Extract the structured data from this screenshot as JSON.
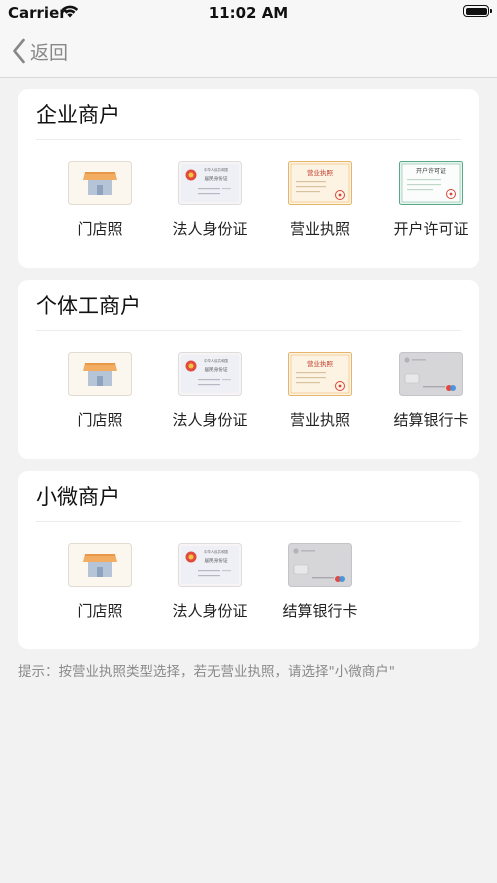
{
  "status_bar": {
    "carrier": "Carrier",
    "time": "11:02 AM"
  },
  "nav": {
    "back_label": "返回"
  },
  "sections": [
    {
      "title": "企业商户",
      "items": [
        {
          "label": "门店照",
          "icon": "storefront-photo-icon"
        },
        {
          "label": "法人身份证",
          "icon": "id-card-icon"
        },
        {
          "label": "营业执照",
          "icon": "business-license-icon"
        },
        {
          "label": "开户许可证",
          "icon": "account-permit-icon"
        }
      ]
    },
    {
      "title": "个体工商户",
      "items": [
        {
          "label": "门店照",
          "icon": "storefront-photo-icon"
        },
        {
          "label": "法人身份证",
          "icon": "id-card-icon"
        },
        {
          "label": "营业执照",
          "icon": "business-license-icon"
        },
        {
          "label": "结算银行卡",
          "icon": "bank-card-icon"
        }
      ]
    },
    {
      "title": "小微商户",
      "items": [
        {
          "label": "门店照",
          "icon": "storefront-photo-icon"
        },
        {
          "label": "法人身份证",
          "icon": "id-card-icon"
        },
        {
          "label": "结算银行卡",
          "icon": "bank-card-icon"
        }
      ]
    }
  ],
  "hint": "提示：按营业执照类型选择，若无营业执照，请选择\"小微商户\"",
  "thumb_text": {
    "id_card_header": "中华人民共和国",
    "id_card_title": "居民身份证",
    "license_title": "营业执照",
    "permit_title": "开户许可证"
  }
}
